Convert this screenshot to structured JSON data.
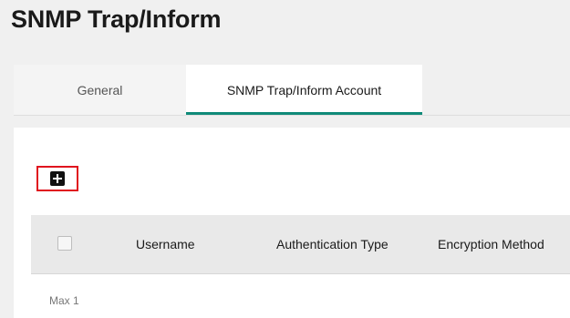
{
  "page": {
    "title": "SNMP Trap/Inform"
  },
  "tabs": [
    {
      "label": "General",
      "active": false
    },
    {
      "label": "SNMP Trap/Inform Account",
      "active": true
    }
  ],
  "toolbar": {
    "add_icon": "plus-square-icon",
    "highlight_color": "#e0141e"
  },
  "table": {
    "columns": [
      "Username",
      "Authentication Type",
      "Encryption Method"
    ],
    "rows": []
  },
  "footer": {
    "max_text": "Max 1"
  },
  "colors": {
    "accent": "#0f8a79",
    "background": "#f0f0f0"
  }
}
